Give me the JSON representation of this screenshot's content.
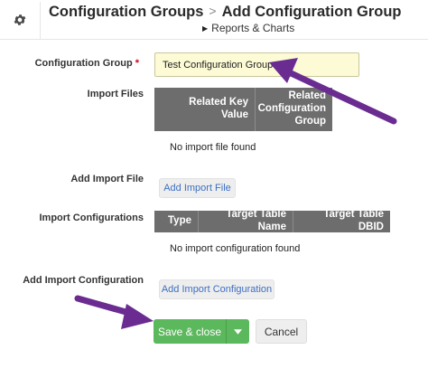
{
  "header": {
    "icon": "gear-icon",
    "parent_title": "Configuration Groups",
    "separator": ">",
    "current_title": "Add Configuration Group",
    "sub_link": "Reports & Charts"
  },
  "form": {
    "configuration_group": {
      "label": "Configuration Group",
      "required_mark": "*",
      "value": "Test Configuration Group"
    },
    "import_files": {
      "label": "Import Files",
      "columns": [
        "Related Key Value",
        "Related Configuration Group"
      ],
      "empty_message": "No import file found"
    },
    "add_import_file": {
      "label": "Add Import File",
      "button_label": "Add Import File"
    },
    "import_configurations": {
      "label": "Import Configurations",
      "columns": [
        "Type",
        "Target Table Name",
        "Target Table DBID"
      ],
      "empty_message": "No import configuration found"
    },
    "add_import_configuration": {
      "label": "Add Import Configuration",
      "button_label": "Add Import Configuration"
    }
  },
  "actions": {
    "save_label": "Save & close",
    "cancel_label": "Cancel"
  },
  "colors": {
    "save_green": "#5cb85c",
    "annotation_arrow": "#6a2c91",
    "table_header": "#6d6d6d",
    "input_highlight": "#fdfbd5",
    "link_blue": "#3d6fc2"
  }
}
